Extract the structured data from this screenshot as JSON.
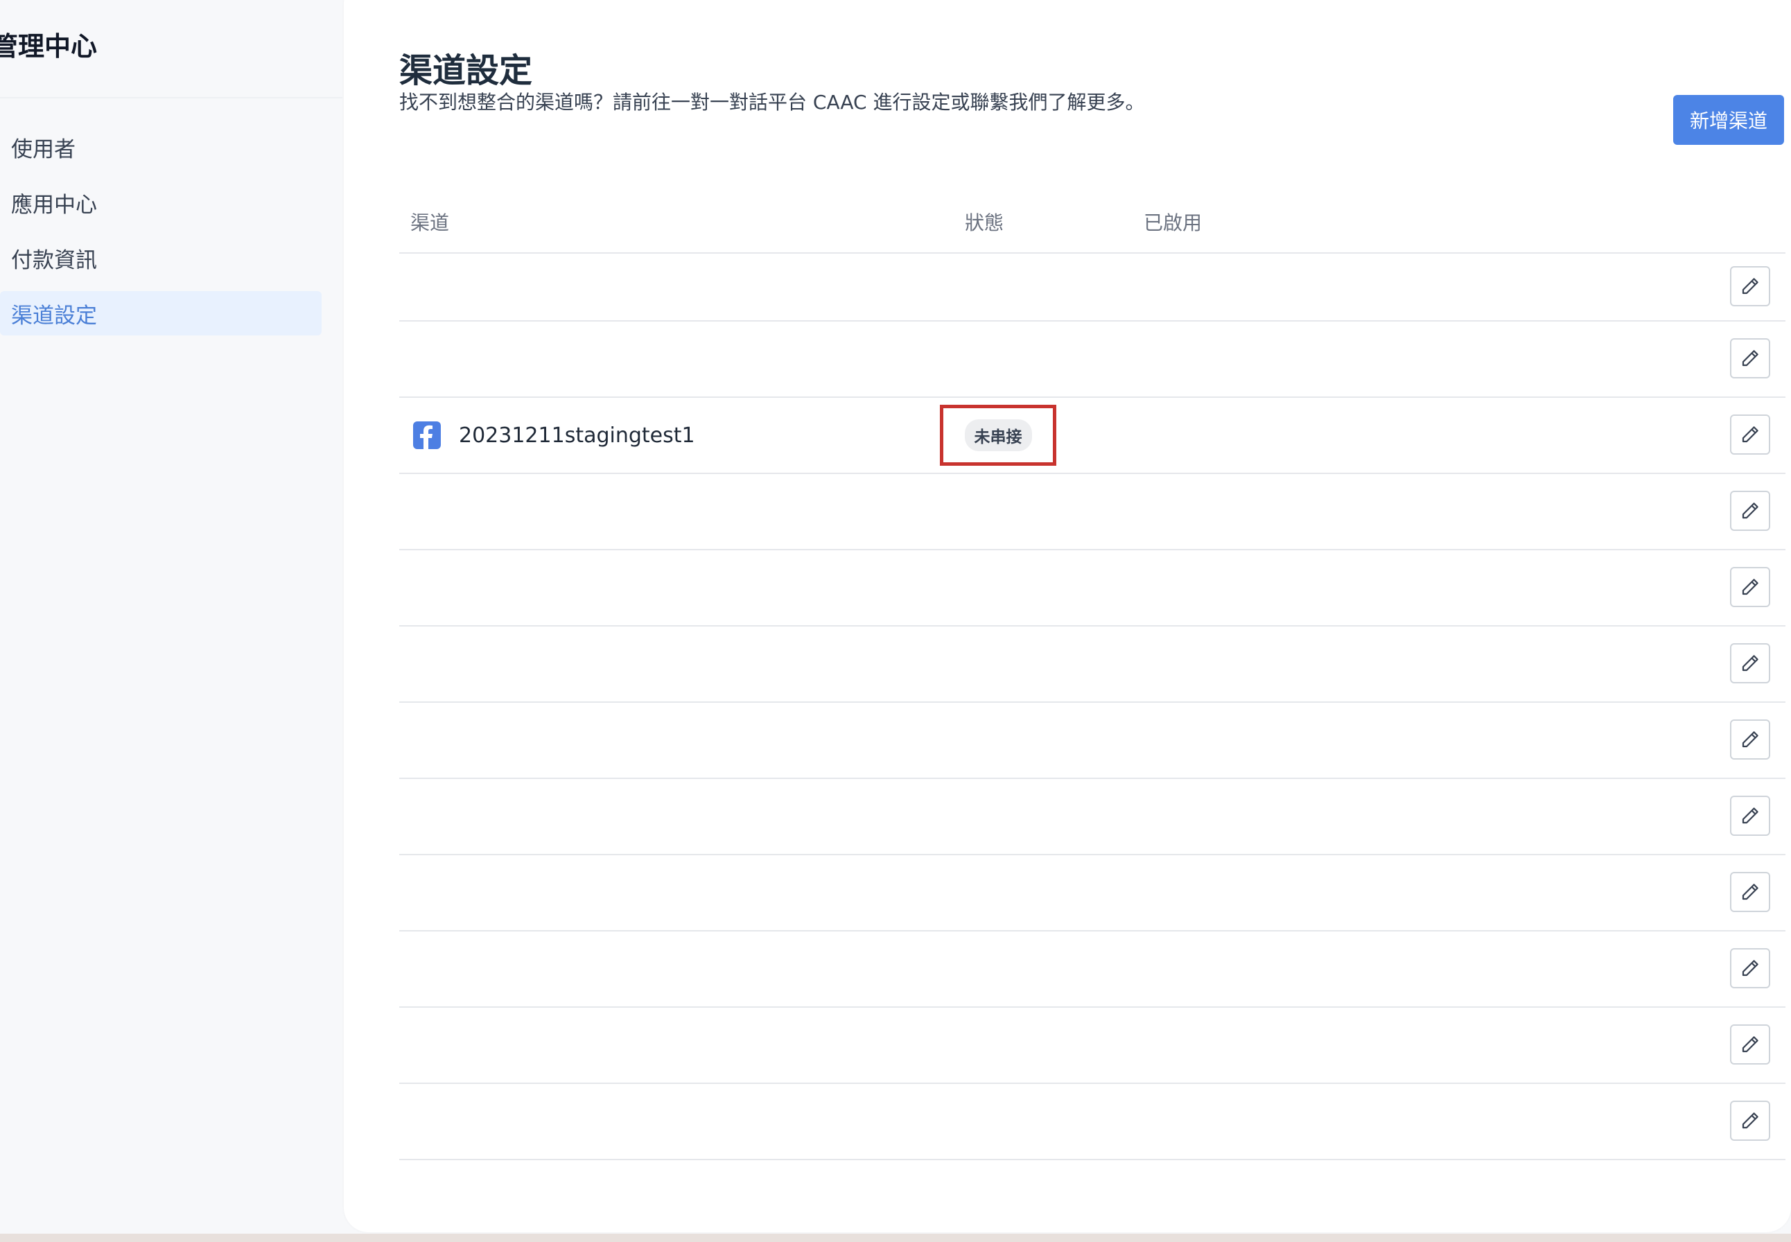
{
  "sidebar": {
    "title": "管理中心",
    "items": [
      {
        "label": "使用者",
        "active": false
      },
      {
        "label": "應用中心",
        "active": false
      },
      {
        "label": "付款資訊",
        "active": false
      },
      {
        "label": "渠道設定",
        "active": true
      }
    ]
  },
  "main": {
    "title": "渠道設定",
    "helper_text": "找不到想整合的渠道嗎？請前往一對一對話平台 CAAC 進行設定或聯繫我們了解更多。",
    "add_button_label": "新增渠道"
  },
  "table": {
    "headers": {
      "channel": "渠道",
      "status": "狀態",
      "enabled": "已啟用"
    },
    "rows": [
      {
        "channel": "",
        "status": ""
      },
      {
        "channel": "",
        "status": ""
      },
      {
        "channel": "20231211stagingtest1",
        "status": "未串接",
        "icon": "facebook-icon",
        "highlighted": true
      },
      {
        "channel": "",
        "status": ""
      },
      {
        "channel": "",
        "status": ""
      },
      {
        "channel": "",
        "status": ""
      },
      {
        "channel": "",
        "status": ""
      },
      {
        "channel": "",
        "status": ""
      },
      {
        "channel": "",
        "status": ""
      },
      {
        "channel": "",
        "status": ""
      },
      {
        "channel": "",
        "status": ""
      },
      {
        "channel": "",
        "status": ""
      }
    ]
  },
  "colors": {
    "accent": "#4c84e6",
    "active_nav_bg": "#e8f1fe",
    "active_nav_text": "#4a7fd6",
    "highlight_border": "#c8332e",
    "facebook": "#4d7fe3"
  }
}
